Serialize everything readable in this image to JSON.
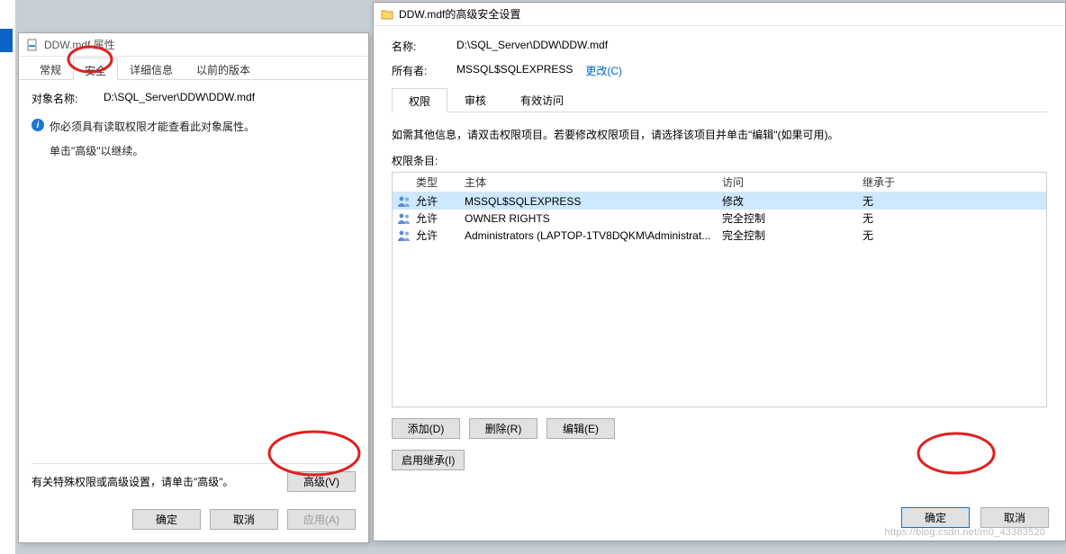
{
  "dlg1": {
    "title": "DDW.mdf 属性",
    "tabs": [
      "常规",
      "安全",
      "详细信息",
      "以前的版本"
    ],
    "active_tab": 1,
    "object_label": "对象名称:",
    "object_value": "D:\\SQL_Server\\DDW\\DDW.mdf",
    "info_line": "你必须具有读取权限才能查看此对象属性。",
    "hint_line": "单击\"高级\"以继续。",
    "footer_hint": "有关特殊权限或高级设置，请单击\"高级\"。",
    "advanced_btn": "高级(V)",
    "ok": "确定",
    "cancel": "取消",
    "apply": "应用(A)"
  },
  "dlg2": {
    "title": "DDW.mdf的高级安全设置",
    "name_label": "名称:",
    "name_value": "D:\\SQL_Server\\DDW\\DDW.mdf",
    "owner_label": "所有者:",
    "owner_value": "MSSQL$SQLEXPRESS",
    "change_link": "更改(C)",
    "tabs": [
      "权限",
      "审核",
      "有效访问"
    ],
    "active_tab": 0,
    "desc": "如需其他信息，请双击权限项目。若要修改权限项目，请选择该项目并单击\"编辑\"(如果可用)。",
    "list_label": "权限条目:",
    "headers": {
      "type": "类型",
      "principal": "主体",
      "access": "访问",
      "inherited": "继承于"
    },
    "entries": [
      {
        "type": "允许",
        "principal": "MSSQL$SQLEXPRESS",
        "access": "修改",
        "inherited": "无"
      },
      {
        "type": "允许",
        "principal": "OWNER RIGHTS",
        "access": "完全控制",
        "inherited": "无"
      },
      {
        "type": "允许",
        "principal": "Administrators (LAPTOP-1TV8DQKM\\Administrat...",
        "access": "完全控制",
        "inherited": "无"
      }
    ],
    "add": "添加(D)",
    "remove": "删除(R)",
    "edit": "编辑(E)",
    "enable_inherit": "启用继承(I)",
    "ok": "确定",
    "cancel": "取消"
  },
  "watermark": "https://blog.csdn.net/m0_43383520"
}
